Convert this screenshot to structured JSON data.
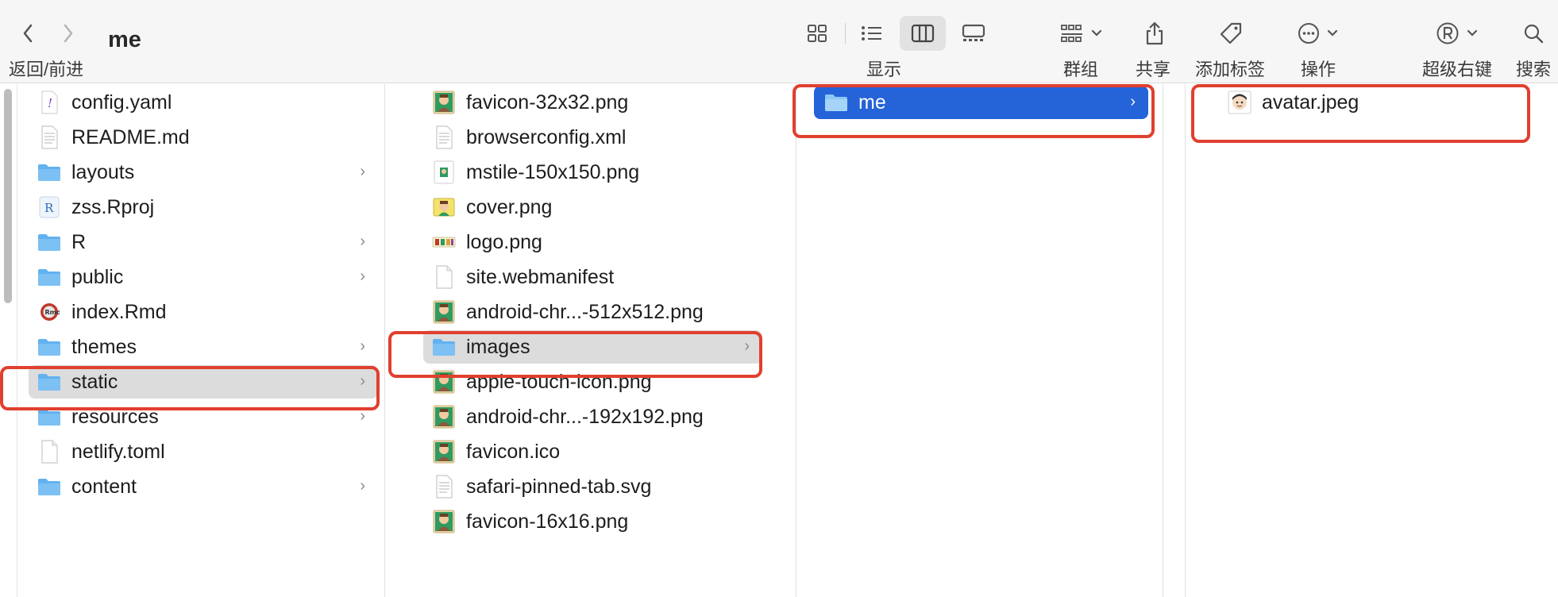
{
  "window": {
    "title": "me"
  },
  "toolbar": {
    "nav_label": "返回/前进",
    "display_label": "显示",
    "group_label": "群组",
    "share_label": "共享",
    "tag_label": "添加标签",
    "action_label": "操作",
    "super_right_label": "超级右键",
    "search_label": "搜索"
  },
  "columns": [
    {
      "items": [
        {
          "name": "config.yaml",
          "icon": "yaml-file-icon",
          "folder": false,
          "selected": ""
        },
        {
          "name": "README.md",
          "icon": "text-document-icon",
          "folder": false,
          "selected": ""
        },
        {
          "name": "layouts",
          "icon": "folder-icon",
          "folder": true,
          "selected": ""
        },
        {
          "name": "zss.Rproj",
          "icon": "rproj-file-icon",
          "folder": false,
          "selected": ""
        },
        {
          "name": "R",
          "icon": "folder-icon",
          "folder": true,
          "selected": ""
        },
        {
          "name": "public",
          "icon": "folder-icon",
          "folder": true,
          "selected": ""
        },
        {
          "name": "index.Rmd",
          "icon": "rmd-file-icon",
          "folder": false,
          "selected": ""
        },
        {
          "name": "themes",
          "icon": "folder-icon",
          "folder": true,
          "selected": ""
        },
        {
          "name": "static",
          "icon": "folder-icon",
          "folder": true,
          "selected": "gray"
        },
        {
          "name": "resources",
          "icon": "folder-icon",
          "folder": true,
          "selected": ""
        },
        {
          "name": "netlify.toml",
          "icon": "blank-file-icon",
          "folder": false,
          "selected": ""
        },
        {
          "name": "content",
          "icon": "folder-icon",
          "folder": true,
          "selected": ""
        }
      ]
    },
    {
      "items": [
        {
          "name": "favicon-32x32.png",
          "icon": "image-thumbnail-icon",
          "folder": false,
          "selected": ""
        },
        {
          "name": "browserconfig.xml",
          "icon": "text-document-icon",
          "folder": false,
          "selected": ""
        },
        {
          "name": "mstile-150x150.png",
          "icon": "image-small-thumbnail-icon",
          "folder": false,
          "selected": ""
        },
        {
          "name": "cover.png",
          "icon": "cover-thumbnail-icon",
          "folder": false,
          "selected": ""
        },
        {
          "name": "logo.png",
          "icon": "logo-thumbnail-icon",
          "folder": false,
          "selected": ""
        },
        {
          "name": "site.webmanifest",
          "icon": "blank-file-icon",
          "folder": false,
          "selected": ""
        },
        {
          "name": "android-chr...-512x512.png",
          "icon": "image-thumbnail-icon",
          "folder": false,
          "selected": ""
        },
        {
          "name": "images",
          "icon": "folder-icon",
          "folder": true,
          "selected": "gray"
        },
        {
          "name": "apple-touch-icon.png",
          "icon": "image-thumbnail-icon",
          "folder": false,
          "selected": ""
        },
        {
          "name": "android-chr...-192x192.png",
          "icon": "image-thumbnail-icon",
          "folder": false,
          "selected": ""
        },
        {
          "name": "favicon.ico",
          "icon": "image-thumbnail-icon",
          "folder": false,
          "selected": ""
        },
        {
          "name": "safari-pinned-tab.svg",
          "icon": "text-document-icon",
          "folder": false,
          "selected": ""
        },
        {
          "name": "favicon-16x16.png",
          "icon": "image-thumbnail-icon",
          "folder": false,
          "selected": ""
        }
      ]
    },
    {
      "items": [
        {
          "name": "me",
          "icon": "folder-icon",
          "folder": true,
          "selected": "blue"
        }
      ]
    },
    {
      "items": [
        {
          "name": "avatar.jpeg",
          "icon": "avatar-thumbnail-icon",
          "folder": false,
          "selected": ""
        }
      ]
    }
  ],
  "colors": {
    "folder": "#62b2f0",
    "selection_blue": "#2563d9",
    "selection_gray": "#dcdcdc",
    "annotation_red": "#e0402f"
  }
}
